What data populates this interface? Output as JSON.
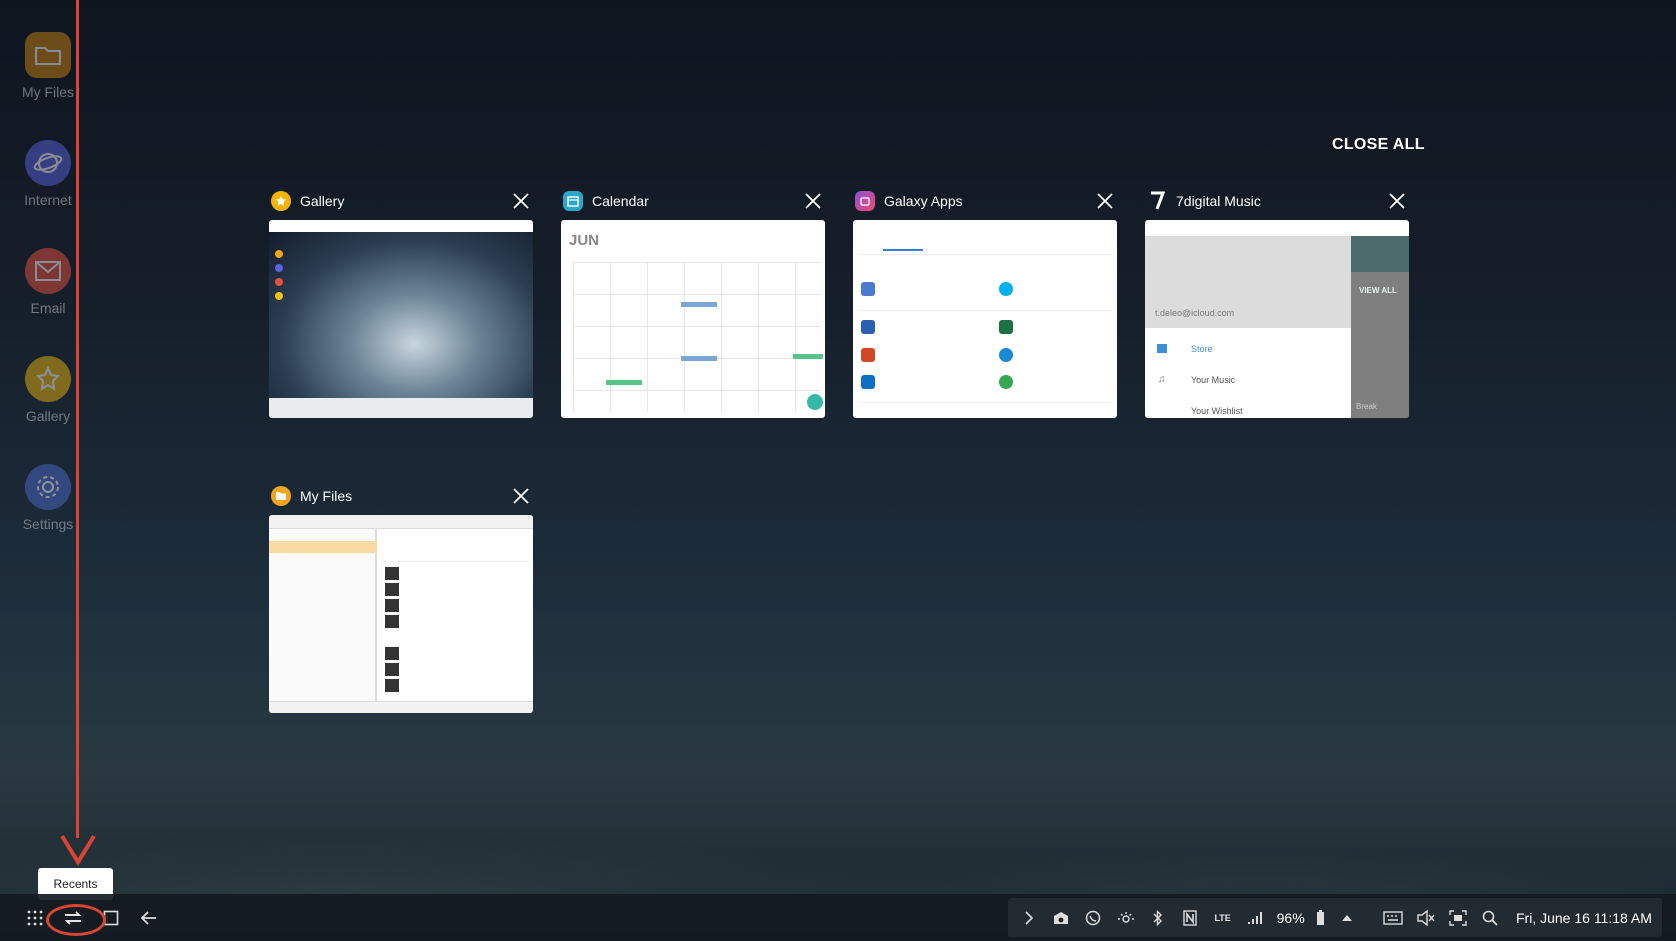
{
  "desktop_icons": [
    {
      "label": "My Files",
      "icon": "folder-icon",
      "color": "#f2a516"
    },
    {
      "label": "Internet",
      "icon": "planet-icon",
      "color": "#5a62e0"
    },
    {
      "label": "Email",
      "icon": "mail-icon",
      "color": "#e5503f"
    },
    {
      "label": "Gallery",
      "icon": "flower-icon",
      "color": "#f4c20d"
    },
    {
      "label": "Settings",
      "icon": "gear-icon",
      "color": "#5b78d9"
    }
  ],
  "recents": {
    "close_all": "CLOSE ALL",
    "cards": [
      {
        "title": "Gallery",
        "icon": "gallery-icon",
        "color": "#f4b400"
      },
      {
        "title": "Calendar",
        "icon": "calendar-icon",
        "color": "#2ca7c9"
      },
      {
        "title": "Galaxy Apps",
        "icon": "galaxy-apps-icon",
        "color": "#d43f8d"
      },
      {
        "title": "7digital Music",
        "icon": "7digital-icon",
        "color": "#ffffff"
      },
      {
        "title": "My Files",
        "icon": "folder-icon",
        "color": "#f2a516"
      }
    ],
    "calendar_thumb": {
      "month": "JUN"
    },
    "music_thumb": {
      "account": "t.deleo@icloud.com",
      "view_all": "VIEW ALL",
      "menu": [
        "Store",
        "Your Music",
        "Your Wishlist"
      ],
      "side_text": "Break"
    }
  },
  "tooltip": "Recents",
  "taskbar": {
    "battery": "96%",
    "datetime": "Fri, June 16  11:18 AM",
    "network": "LTE"
  }
}
